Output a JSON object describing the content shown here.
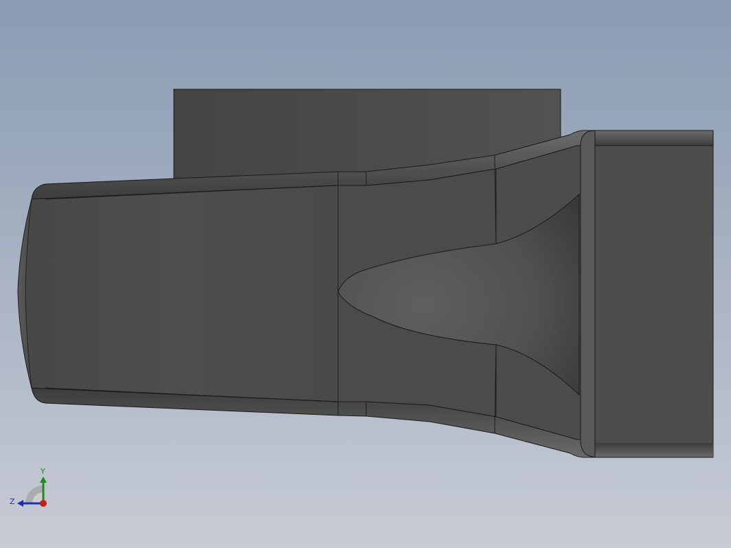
{
  "viewport": {
    "background_top": "#8a9bb2",
    "background_bottom": "#c7cbd5"
  },
  "model": {
    "body_color": "#4d4d4d",
    "edge_color": "#1a1a1a",
    "highlight_color": "#6a6a6a"
  },
  "triad": {
    "x_label": "",
    "y_label": "Y",
    "z_label": "Z",
    "y_color": "#1f8a1f",
    "z_color": "#1f2fb0",
    "x_color": "#c02020"
  }
}
